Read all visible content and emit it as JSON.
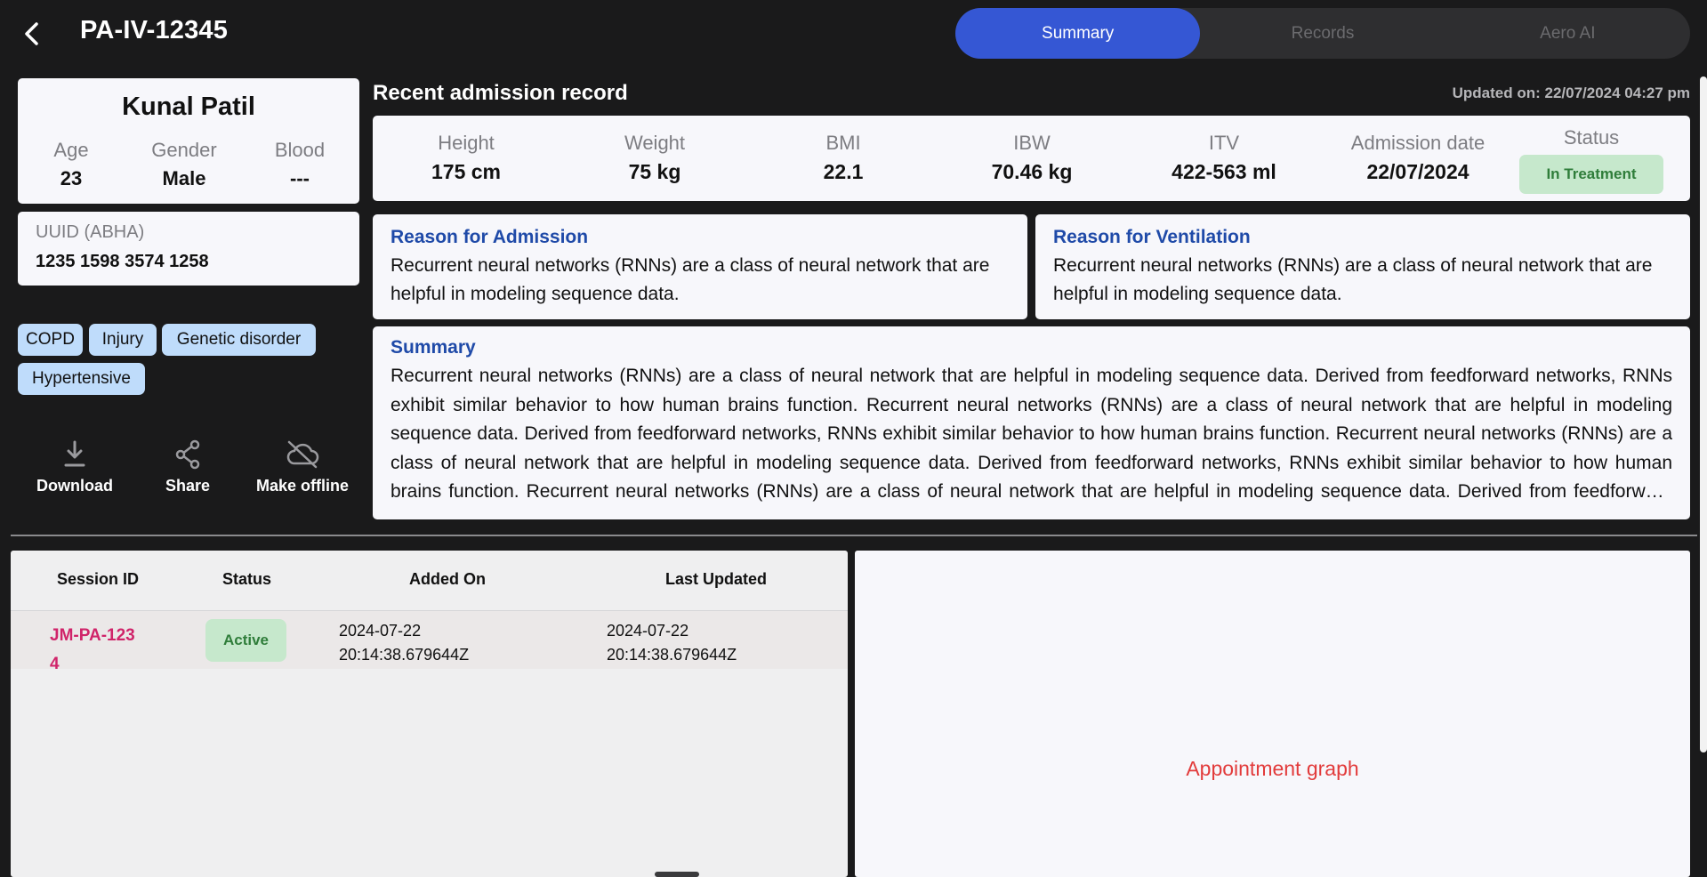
{
  "header": {
    "title": "PA-IV-12345",
    "tabs": [
      {
        "label": "Summary",
        "active": true
      },
      {
        "label": "Records",
        "active": false
      },
      {
        "label": "Aero AI",
        "active": false
      }
    ]
  },
  "patient": {
    "name": "Kunal Patil",
    "age_label": "Age",
    "age": "23",
    "gender_label": "Gender",
    "gender": "Male",
    "blood_label": "Blood",
    "blood": "---",
    "uuid_label": "UUID (ABHA)",
    "uuid": "1235 1598 3574 1258",
    "tags": [
      "COPD",
      "Injury",
      "Genetic disorder",
      "Hypertensive"
    ]
  },
  "actions": {
    "download": "Download",
    "share": "Share",
    "offline": "Make offline"
  },
  "admission": {
    "title": "Recent admission record",
    "updated": "Updated on: 22/07/2024 04:27 pm",
    "vitals": [
      {
        "label": "Height",
        "value": "175 cm"
      },
      {
        "label": "Weight",
        "value": "75 kg"
      },
      {
        "label": "BMI",
        "value": "22.1"
      },
      {
        "label": "IBW",
        "value": "70.46 kg"
      },
      {
        "label": "ITV",
        "value": "422-563 ml"
      },
      {
        "label": "Admission date",
        "value": "22/07/2024"
      }
    ],
    "status_label": "Status",
    "status": "In Treatment",
    "reason_admission_title": "Reason for Admission",
    "reason_admission": "Recurrent neural networks (RNNs) are a class of neural network that are helpful in modeling sequence data.",
    "reason_ventilation_title": "Reason for Ventilation",
    "reason_ventilation": "Recurrent neural networks (RNNs) are a class of neural network that are helpful in modeling sequence data.",
    "summary_title": "Summary",
    "summary": "Recurrent neural networks (RNNs) are a class of neural network that are helpful in modeling sequence data. Derived from feedforward networks, RNNs exhibit similar behavior to how human brains function. Recurrent neural networks (RNNs) are a class of neural network that are helpful in modeling sequence data. Derived from feedforward networks, RNNs exhibit similar behavior to how human brains function. Recurrent neural networks (RNNs) are a class of neural network that are helpful in modeling sequence data. Derived from feedforward networks, RNNs exhibit similar behavior to how human brains function. Recurrent neural networks (RNNs) are a class of neural network that are helpful in modeling sequence data. Derived from feedforward networks, RNNs exhibit similar behavior to how human brains function."
  },
  "sessions": {
    "columns": [
      "Session ID",
      "Status",
      "Added On",
      "Last Updated"
    ],
    "rows": [
      {
        "id": "JM-PA-1234",
        "status": "Active",
        "added": "2024-07-22 20:14:38.679644Z",
        "updated": "2024-07-22 20:14:38.679644Z"
      }
    ]
  },
  "graph": {
    "label": "Appointment graph"
  },
  "colors": {
    "accent": "#3557d4",
    "link": "#d0246a",
    "heading_blue": "#1f4aa8",
    "status_green_bg": "#c6e8cc",
    "status_green_text": "#2f7d3a",
    "tag_bg": "#bfdcfb",
    "graph_label": "#e23b3b"
  }
}
